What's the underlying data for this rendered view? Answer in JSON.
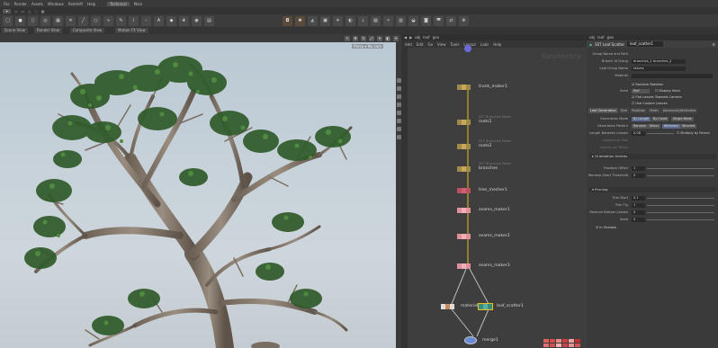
{
  "menubar": [
    "File",
    "Render",
    "Assets",
    "Windows",
    "Redshift",
    "Help"
  ],
  "desktop": {
    "name": "Technical",
    "build": "Main"
  },
  "shelf_tools": [
    "Box",
    "Sphere",
    "Tube",
    "Torus",
    "Grid",
    "Null",
    "Line",
    "Circle",
    "Curve",
    "Draw Curve",
    "Path",
    "Spray Paint",
    "Font",
    "Platonic",
    "L-System",
    "Metaball",
    "File"
  ],
  "tabs_left": [
    "Scene View",
    "Render View",
    "Composite View",
    "Motion FX View"
  ],
  "tabs_right": [
    "Lights and Cameras",
    "Collisions",
    "Particles",
    "Grains",
    "Vellum",
    "Rigid Bodies",
    "Particle Fluids",
    "Viscous Fluids",
    "Oceans",
    "Pyro FX",
    "FEM",
    "Wires",
    "Crowds",
    "Drive Simulation"
  ],
  "viewport": {
    "persp": "Persp",
    "cam": "No cam"
  },
  "network": {
    "path": [
      "obj",
      "leaf",
      "geo"
    ],
    "menu": [
      "Add",
      "Edit",
      "Go",
      "View",
      "Tools",
      "Layout",
      "Labs",
      "Help"
    ],
    "context": "Geometry",
    "nodes": [
      {
        "label": "trunk_maker1",
        "comment": ""
      },
      {
        "label": "roots1",
        "comment": "SST Branches Maker"
      },
      {
        "label": "roots2",
        "comment": "SST Branches Maker"
      },
      {
        "label": "branches",
        "comment": "SST Branches Maker"
      },
      {
        "label": "tree_mesher1",
        "comment": ""
      },
      {
        "label": "seams_maker1",
        "comment": ""
      },
      {
        "label": "seams_maker2",
        "comment": ""
      },
      {
        "label": "seams_maker3",
        "comment": ""
      },
      {
        "label": "material1",
        "comment": ""
      },
      {
        "label": "leaf_scatter1",
        "comment": ""
      },
      {
        "label": "merge1",
        "comment": ""
      }
    ],
    "palette": [
      "#e06060",
      "#d84a4a",
      "#e88a8a",
      "#c94040",
      "#f0a0a0",
      "#b83030",
      "#e07070",
      "#d05050",
      "#f2b0b0",
      "#c04848",
      "#e89090",
      "#cc5555"
    ]
  },
  "params": {
    "path": [
      "obj",
      "leaf",
      "geo"
    ],
    "node_type": "SST Leaf Scatter",
    "node_name": "leaf_scatter1",
    "rows_top": [
      {
        "label": "Group Name and Path",
        "value": ""
      },
      {
        "label": "Branch Id Group",
        "value": "branches_1 branches_2"
      },
      {
        "label": "Leaf Group Name",
        "value": "leaves"
      },
      {
        "label": "Material",
        "value": ""
      }
    ],
    "checks": [
      {
        "label": "Random Rotation",
        "checked": true
      },
      {
        "label": "Flat Leaves Towards Camera",
        "checked": true
      },
      {
        "label": "Use Custom Leaves",
        "checked": false
      }
    ],
    "seed": {
      "label": "Seed",
      "value": "Perf",
      "extra": "Display Seed"
    },
    "tabs": [
      "Leaf Generation",
      "Size",
      "Rotation",
      "Mesh",
      "Advanced/Attributes"
    ],
    "rows_gen": [
      {
        "label": "Generation Mode",
        "opts": [
          "By Length",
          "By Count",
          "Single Mode"
        ]
      },
      {
        "label": "Generation Pattern",
        "opts": [
          "Random",
          "Mirror",
          "Alternate",
          "Whorled"
        ]
      },
      {
        "label": "Length Between Leaves",
        "value": "0.08",
        "extra": "Multiply by Parent"
      },
      {
        "label": "Leaves per Row",
        "value": ""
      },
      {
        "label": "Leaves per Whorl",
        "value": ""
      }
    ],
    "orientation": "Orientation Indices",
    "rows_mid": [
      {
        "label": "Random Offset",
        "value": "1"
      },
      {
        "label": "Remove Short Threshold",
        "value": "0"
      }
    ],
    "pruning": "Pruning",
    "rows_prune": [
      {
        "label": "Trim Start",
        "value": "0.1"
      },
      {
        "label": "Trim Tip",
        "value": "1"
      },
      {
        "label": "Remove Bottom Leaves",
        "value": "0"
      },
      {
        "label": "Seed",
        "value": "0"
      }
    ],
    "shadow": "In Shadow"
  }
}
